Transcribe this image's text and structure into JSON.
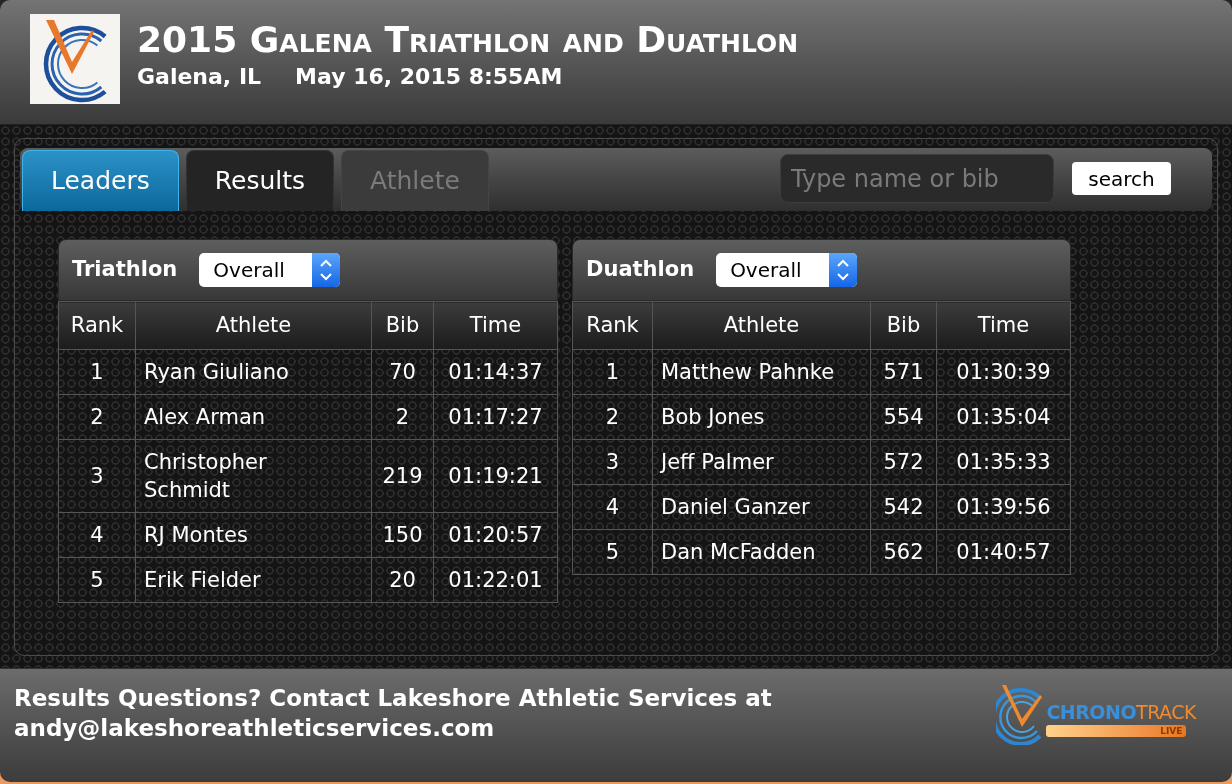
{
  "header": {
    "title": "2015 Galena Triathlon and Duathlon",
    "location": "Galena, IL",
    "datetime": "May 16, 2015 8:55AM"
  },
  "tabs": [
    {
      "label": "Leaders",
      "selected": true,
      "disabled": false
    },
    {
      "label": "Results",
      "selected": false,
      "disabled": false
    },
    {
      "label": "Athlete",
      "selected": false,
      "disabled": true
    }
  ],
  "search": {
    "placeholder": "Type name or bib",
    "button": "search"
  },
  "leaderboards": [
    {
      "title": "Triathlon",
      "filter": "Overall",
      "columns": [
        "Rank",
        "Athlete",
        "Bib",
        "Time"
      ],
      "rows": [
        [
          "1",
          "Ryan Giuliano",
          "70",
          "01:14:37"
        ],
        [
          "2",
          "Alex Arman",
          "2",
          "01:17:27"
        ],
        [
          "3",
          "Christopher Schmidt",
          "219",
          "01:19:21"
        ],
        [
          "4",
          "RJ Montes",
          "150",
          "01:20:57"
        ],
        [
          "5",
          "Erik Fielder",
          "20",
          "01:22:01"
        ]
      ]
    },
    {
      "title": "Duathlon",
      "filter": "Overall",
      "columns": [
        "Rank",
        "Athlete",
        "Bib",
        "Time"
      ],
      "rows": [
        [
          "1",
          "Matthew Pahnke",
          "571",
          "01:30:39"
        ],
        [
          "2",
          "Bob Jones",
          "554",
          "01:35:04"
        ],
        [
          "3",
          "Jeff Palmer",
          "572",
          "01:35:33"
        ],
        [
          "4",
          "Daniel Ganzer",
          "542",
          "01:39:56"
        ],
        [
          "5",
          "Dan McFadden",
          "562",
          "01:40:57"
        ]
      ]
    }
  ],
  "footer": {
    "contact": "Results Questions? Contact Lakeshore Athletic Services at",
    "email": "andy@lakeshoreathleticservices.com",
    "logo": {
      "word_1": "CHRONO",
      "word_2": "TRACK",
      "tag": "LIVE"
    }
  }
}
